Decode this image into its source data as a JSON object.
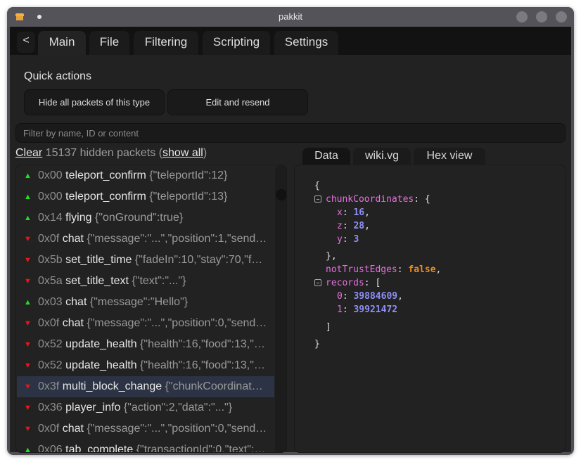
{
  "window": {
    "title": "pakkit"
  },
  "tabs": {
    "back_label": "<",
    "items": [
      {
        "label": "Main",
        "active": true
      },
      {
        "label": "File",
        "active": false
      },
      {
        "label": "Filtering",
        "active": false
      },
      {
        "label": "Scripting",
        "active": false
      },
      {
        "label": "Settings",
        "active": false
      }
    ]
  },
  "quick_actions": {
    "label": "Quick actions",
    "hide_button": "Hide all packets of this type",
    "resend_button": "Edit and resend"
  },
  "filter": {
    "placeholder": "Filter by name, ID or content",
    "value": ""
  },
  "hidden": {
    "clear_label": "Clear",
    "count_text": " 15137 hidden packets (",
    "show_all_label": "show all",
    "close_paren": ")"
  },
  "packets": [
    {
      "direction": "up",
      "id": "0x00",
      "name": "teleport_confirm",
      "data": "{\"teleportId\":12}"
    },
    {
      "direction": "up",
      "id": "0x00",
      "name": "teleport_confirm",
      "data": "{\"teleportId\":13}"
    },
    {
      "direction": "up",
      "id": "0x14",
      "name": "flying",
      "data": "{\"onGround\":true}"
    },
    {
      "direction": "down",
      "id": "0x0f",
      "name": "chat",
      "data": "{\"message\":\"...\",\"position\":1,\"send…"
    },
    {
      "direction": "down",
      "id": "0x5b",
      "name": "set_title_time",
      "data": "{\"fadeIn\":10,\"stay\":70,\"f…"
    },
    {
      "direction": "down",
      "id": "0x5a",
      "name": "set_title_text",
      "data": "{\"text\":\"...\"}"
    },
    {
      "direction": "up",
      "id": "0x03",
      "name": "chat",
      "data": "{\"message\":\"Hello\"}"
    },
    {
      "direction": "down",
      "id": "0x0f",
      "name": "chat",
      "data": "{\"message\":\"...\",\"position\":0,\"send…"
    },
    {
      "direction": "down",
      "id": "0x52",
      "name": "update_health",
      "data": "{\"health\":16,\"food\":13,\"…"
    },
    {
      "direction": "down",
      "id": "0x52",
      "name": "update_health",
      "data": "{\"health\":16,\"food\":13,\"…"
    },
    {
      "direction": "down",
      "id": "0x3f",
      "name": "multi_block_change",
      "data": "{\"chunkCoordinat…",
      "selected": true
    },
    {
      "direction": "down",
      "id": "0x36",
      "name": "player_info",
      "data": "{\"action\":2,\"data\":\"...\"}"
    },
    {
      "direction": "down",
      "id": "0x0f",
      "name": "chat",
      "data": "{\"message\":\"...\",\"position\":0,\"send…"
    },
    {
      "direction": "up",
      "id": "0x06",
      "name": "tab_complete",
      "data": "{\"transactionId\":0,\"text\":…"
    }
  ],
  "detail_tabs": [
    {
      "label": "Data",
      "active": true
    },
    {
      "label": "wiki.vg",
      "active": false
    },
    {
      "label": "Hex view",
      "active": false
    }
  ],
  "detail": {
    "open_brace": "{",
    "close_brace": "}",
    "chunkCoordinates": {
      "key": "chunkCoordinates",
      "x_key": "x",
      "x": "16",
      "z_key": "z",
      "z": "28",
      "y_key": "y",
      "y": "3"
    },
    "notTrustEdges": {
      "key": "notTrustEdges",
      "value": "false"
    },
    "records": {
      "key": "records",
      "items": [
        {
          "index": "0",
          "value": "39884609"
        },
        {
          "index": "1",
          "value": "39921472"
        }
      ]
    }
  }
}
